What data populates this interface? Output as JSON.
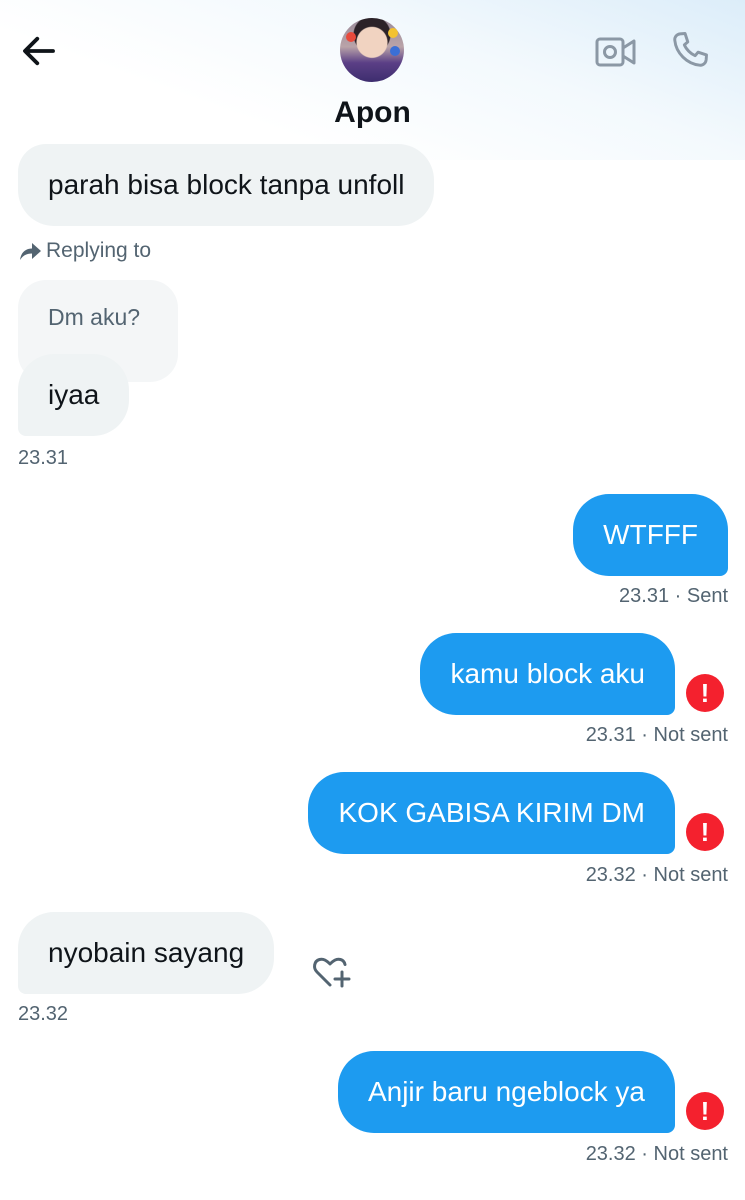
{
  "header": {
    "contact_name": "Apon",
    "icons": {
      "back": "arrow-left-icon",
      "video": "video-camera-icon",
      "call": "phone-icon"
    }
  },
  "messages": [
    {
      "direction": "in",
      "text": "parah bisa block tanpa unfoll"
    },
    {
      "direction": "in",
      "reply_label": "Replying to",
      "quoted_text": "Dm aku?",
      "text": "iyaa",
      "time": "23.31"
    },
    {
      "direction": "out",
      "text": "WTFFF",
      "time_status": "23.31 · Sent"
    },
    {
      "direction": "out",
      "text": "kamu block aku",
      "time_status": "23.31 · Not sent",
      "error": "!"
    },
    {
      "direction": "out",
      "text": "KOK GABISA KIRIM DM",
      "time_status": "23.32 · Not sent",
      "error": "!"
    },
    {
      "direction": "in",
      "text": "nyobain sayang",
      "time": "23.32",
      "reaction_icon": "heart-plus-icon"
    },
    {
      "direction": "out",
      "text": "Anjir baru ngeblock ya",
      "time_status": "23.32 · Not sent",
      "error": "!"
    }
  ],
  "colors": {
    "incoming_bubble": "#eff3f4",
    "outgoing_bubble": "#1d9bf0",
    "error": "#f4212e",
    "secondary_text": "#536471"
  }
}
